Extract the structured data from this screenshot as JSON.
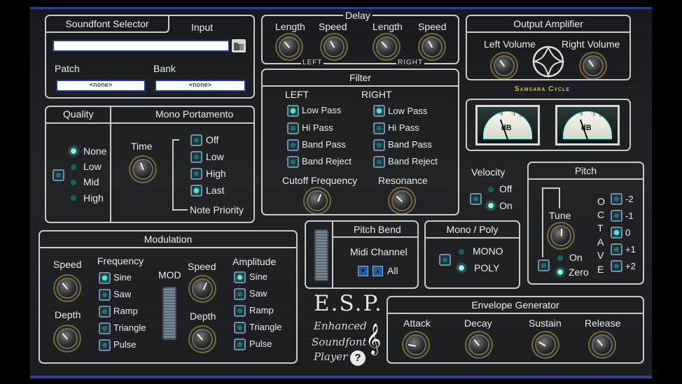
{
  "soundfont": {
    "title": "Soundfont Selector",
    "input_label": "Input",
    "input_value": "",
    "patch_label": "Patch",
    "bank_label": "Bank",
    "patch_value": "<none>",
    "bank_value": "<none>"
  },
  "delay": {
    "title": "Delay",
    "length_label": "Length",
    "speed_label": "Speed",
    "left_label": "LEFT",
    "right_label": "RIGHT"
  },
  "output": {
    "title": "Output Amplifier",
    "left_volume": "Left Volume",
    "right_volume": "Right Volume",
    "brand": "Samsara Cycle"
  },
  "filter": {
    "title": "Filter",
    "left_label": "LEFT",
    "right_label": "RIGHT",
    "types": [
      "Low Pass",
      "Hi Pass",
      "Band Pass",
      "Band Reject"
    ],
    "left_selected": "Low Pass",
    "right_selected": "Low Pass",
    "cutoff_label": "Cutoff Frequency",
    "resonance_label": "Resonance"
  },
  "meters": {
    "db_label": "dB",
    "scale": [
      "-20",
      "-5",
      "-1",
      "0",
      "3"
    ]
  },
  "quality": {
    "title": "Quality",
    "options": [
      "None",
      "Low",
      "Mid",
      "High"
    ],
    "selected": "None"
  },
  "portamento": {
    "title": "Mono Portamento",
    "time_label": "Time",
    "priority": [
      "Off",
      "Low",
      "High",
      "Last"
    ],
    "selected": "Last",
    "priority_label": "Note Priority"
  },
  "velocity": {
    "title": "Velocity",
    "off_label": "Off",
    "on_label": "On",
    "selected": "On"
  },
  "pitch": {
    "title": "Pitch",
    "tune_label": "Tune",
    "on_label": "On",
    "zero_label": "Zero",
    "zero_selected": "Zero",
    "octave_letters": [
      "O",
      "C",
      "T",
      "A",
      "V",
      "E"
    ],
    "octaves": [
      "-2",
      "-1",
      "0",
      "+1",
      "+2"
    ],
    "octave_selected": "0"
  },
  "modulation": {
    "title": "Modulation",
    "speed_label": "Speed",
    "depth_label": "Depth",
    "frequency_label": "Frequency",
    "amplitude_label": "Amplitude",
    "mod_label": "MOD",
    "waves": [
      "Sine",
      "Saw",
      "Ramp",
      "Triangle",
      "Pulse"
    ],
    "frequency_selected": "Sine",
    "amplitude_selected": "Sine"
  },
  "pitchbend": {
    "title": "Pitch Bend",
    "midi_channel_label": "Midi Channel",
    "midi_channel_value": "All"
  },
  "monopoly": {
    "title": "Mono / Poly",
    "mono_label": "MONO",
    "poly_label": "POLY",
    "selected": "POLY"
  },
  "envelope": {
    "title": "Envelope Generator",
    "attack": "Attack",
    "decay": "Decay",
    "sustain": "Sustain",
    "release": "Release"
  },
  "logo": {
    "title": "E.S.P.",
    "line1": "Enhanced",
    "line2": "Soundfont",
    "line3": "Player",
    "help": "?"
  },
  "colors": {
    "accent": "#2b3f9a",
    "led_on": "#8ff7e6",
    "brand": "#e0b648"
  }
}
